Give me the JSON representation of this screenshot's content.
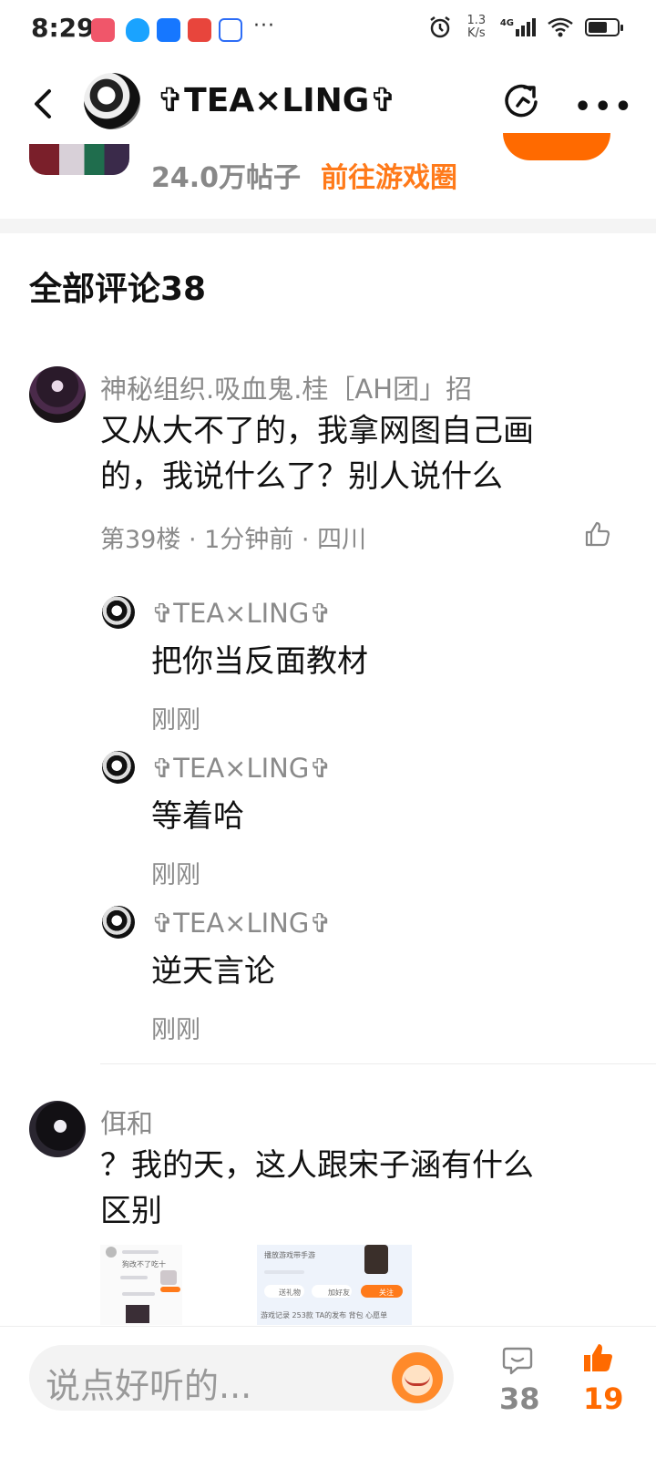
{
  "status_bar": {
    "time": "8:29",
    "net_speed_value": "1.3",
    "net_speed_unit": "K/s",
    "network": "4G",
    "more": "···"
  },
  "header": {
    "title": "✞TEA×LING✞",
    "more": "•••"
  },
  "game_circle": {
    "post_count": "24.0万帖子",
    "goto_label": "前往游戏圈"
  },
  "comments_section": {
    "title": "全部评论38"
  },
  "comments": [
    {
      "user": "神秘组织.吸血鬼.桂［AH团」招",
      "text_line1": "又从大不了的，我拿网图自己画",
      "text_line2": "的，我说什么了？别人说什么",
      "meta": "第39楼 · 1分钟前 · 四川",
      "replies": [
        {
          "user": "✞TEA×LING✞",
          "text": "把你当反面教材",
          "time": "刚刚"
        },
        {
          "user": "✞TEA×LING✞",
          "text": "等着哈",
          "time": "刚刚"
        },
        {
          "user": "✞TEA×LING✞",
          "text": "逆天言论",
          "time": "刚刚"
        }
      ]
    },
    {
      "user": "佴和",
      "text_line1": "？我的天，这人跟宋子涵有什么",
      "text_line2": "区别"
    }
  ],
  "thumbnails": {
    "a_text": "狗改不了吃十",
    "b_line1": "播放游戏带手游",
    "b_gift": "送礼物",
    "b_friend": "加好友",
    "b_follow": "关注",
    "b_tabs": "游戏记录  253款  TA的发布  背包  心愿单"
  },
  "bottom_bar": {
    "input_placeholder": "说点好听的...",
    "comment_count": "38",
    "like_count": "19"
  },
  "colors": {
    "accent": "#ff6a00",
    "muted_text": "#8a8a8a"
  }
}
